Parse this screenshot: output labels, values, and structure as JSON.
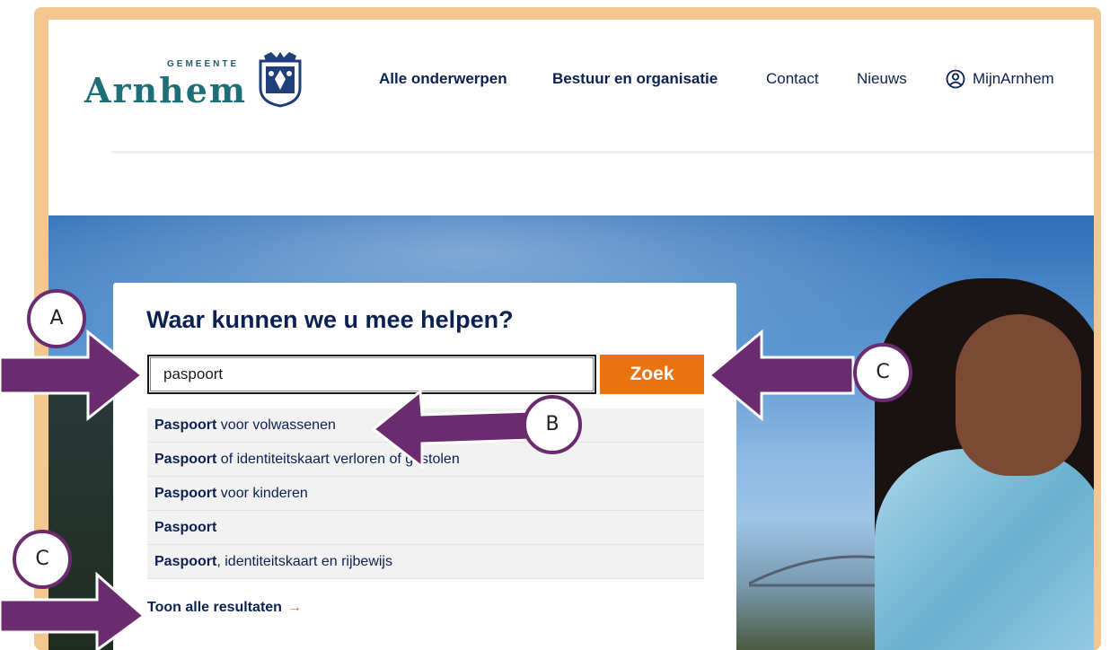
{
  "header": {
    "logo_small": "GEMEENTE",
    "logo_main": "Arnhem",
    "nav": [
      {
        "label": "Alle onderwerpen",
        "bold": true
      },
      {
        "label": "Bestuur en organisatie",
        "bold": true
      },
      {
        "label": "Contact",
        "bold": false
      },
      {
        "label": "Nieuws",
        "bold": false
      },
      {
        "label": "MijnArnhem",
        "bold": false
      }
    ]
  },
  "search": {
    "title": "Waar kunnen we u mee helpen?",
    "value": "paspoort",
    "button": "Zoek",
    "suggestions": [
      {
        "bold": "Paspoort",
        "rest": " voor volwassenen"
      },
      {
        "bold": "Paspoort",
        "rest": " of identiteitskaart verloren of gestolen"
      },
      {
        "bold": "Paspoort",
        "rest": " voor kinderen"
      },
      {
        "bold": "Paspoort",
        "rest": ""
      },
      {
        "bold": "Paspoort",
        "rest": ", identiteitskaart en rijbewijs"
      }
    ],
    "show_all": "Toon alle resultaten",
    "show_all_arrow": "→"
  },
  "annotations": {
    "a": "A",
    "b": "B",
    "c1": "C",
    "c2": "C"
  },
  "colors": {
    "accent": "#e8730f",
    "navy": "#0b2152",
    "callout_border": "#6b2c6f",
    "frame": "#f3c78f"
  }
}
